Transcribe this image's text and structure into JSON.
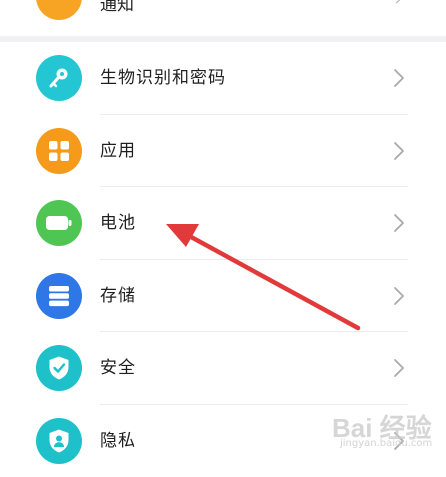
{
  "top_item": {
    "label": "通知",
    "icon": "bell-icon",
    "icon_color": "#f7a425"
  },
  "settings": [
    {
      "label": "生物识别和密码",
      "icon": "key-icon",
      "icon_color": "#23c6d2"
    },
    {
      "label": "应用",
      "icon": "apps-grid-icon",
      "icon_color": "#f59a1b"
    },
    {
      "label": "电池",
      "icon": "battery-icon",
      "icon_color": "#4fc654"
    },
    {
      "label": "存储",
      "icon": "storage-icon",
      "icon_color": "#2f76e6"
    },
    {
      "label": "安全",
      "icon": "shield-check-icon",
      "icon_color": "#1ec1c9"
    },
    {
      "label": "隐私",
      "icon": "privacy-icon",
      "icon_color": "#1ec1c9"
    }
  ],
  "annotation": {
    "arrow_color": "#e23a3a",
    "points_to": "电池"
  },
  "watermark": {
    "text": "Bai 经验",
    "sub": "jingyan.baidu.com"
  }
}
